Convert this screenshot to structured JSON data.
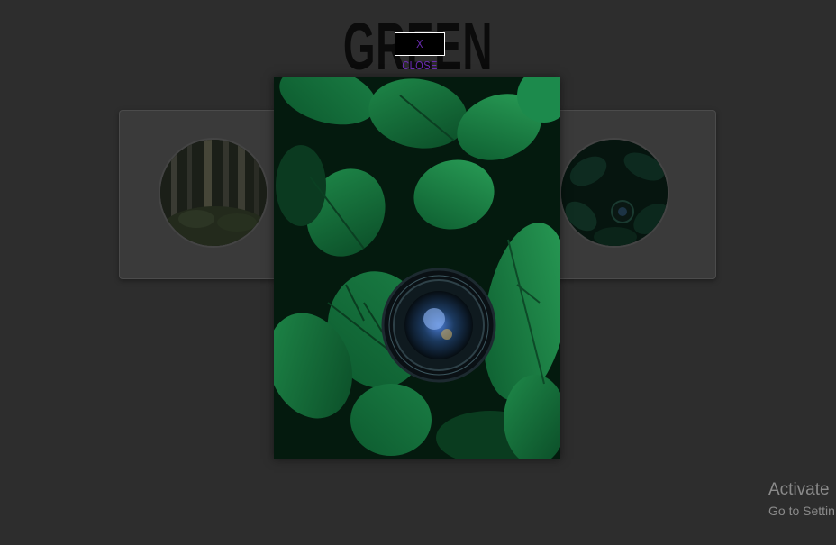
{
  "page": {
    "title": "GREEN"
  },
  "modal": {
    "close_label": "X CLOSE",
    "image_icon": "leaves-camera-lens-photo"
  },
  "gallery": {
    "left_thumb_icon": "forest-photo",
    "right_thumb_icon": "leaves-photo"
  },
  "watermark": {
    "title": "Activate",
    "subtitle": "Go to Settin"
  },
  "colors": {
    "background": "#2d2d2d",
    "card": "#3a3a3a",
    "close_text": "#6a2bb0"
  }
}
